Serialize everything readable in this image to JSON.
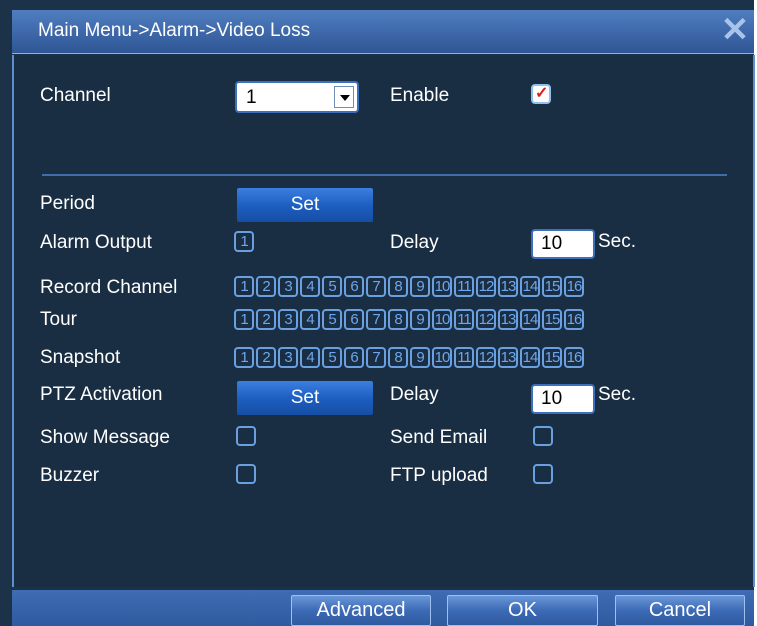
{
  "window": {
    "title": "Main Menu->Alarm->Video Loss",
    "close_icon": "close-icon"
  },
  "channel": {
    "label": "Channel",
    "value": "1"
  },
  "enable": {
    "label": "Enable",
    "checked": true
  },
  "period": {
    "label": "Period",
    "button": "Set"
  },
  "alarm_output": {
    "label": "Alarm Output",
    "channels": [
      "1"
    ]
  },
  "delay1": {
    "label": "Delay",
    "value": "10",
    "unit": "Sec."
  },
  "record_channel": {
    "label": "Record Channel",
    "channels": [
      "1",
      "2",
      "3",
      "4",
      "5",
      "6",
      "7",
      "8",
      "9",
      "10",
      "11",
      "12",
      "13",
      "14",
      "15",
      "16"
    ]
  },
  "tour": {
    "label": "Tour",
    "channels": [
      "1",
      "2",
      "3",
      "4",
      "5",
      "6",
      "7",
      "8",
      "9",
      "10",
      "11",
      "12",
      "13",
      "14",
      "15",
      "16"
    ]
  },
  "snapshot": {
    "label": "Snapshot",
    "channels": [
      "1",
      "2",
      "3",
      "4",
      "5",
      "6",
      "7",
      "8",
      "9",
      "10",
      "11",
      "12",
      "13",
      "14",
      "15",
      "16"
    ]
  },
  "ptz": {
    "label": "PTZ Activation",
    "button": "Set"
  },
  "delay2": {
    "label": "Delay",
    "value": "10",
    "unit": "Sec."
  },
  "show_message": {
    "label": "Show Message",
    "checked": false
  },
  "send_email": {
    "label": "Send Email",
    "checked": false
  },
  "buzzer": {
    "label": "Buzzer",
    "checked": false
  },
  "ftp_upload": {
    "label": "FTP upload",
    "checked": false
  },
  "footer": {
    "advanced": "Advanced",
    "ok": "OK",
    "cancel": "Cancel"
  },
  "colors": {
    "panel": "#1a2e43",
    "title_bar": "#3d67a8",
    "accent": "#6a9fe0",
    "check_mark": "#d92020"
  }
}
